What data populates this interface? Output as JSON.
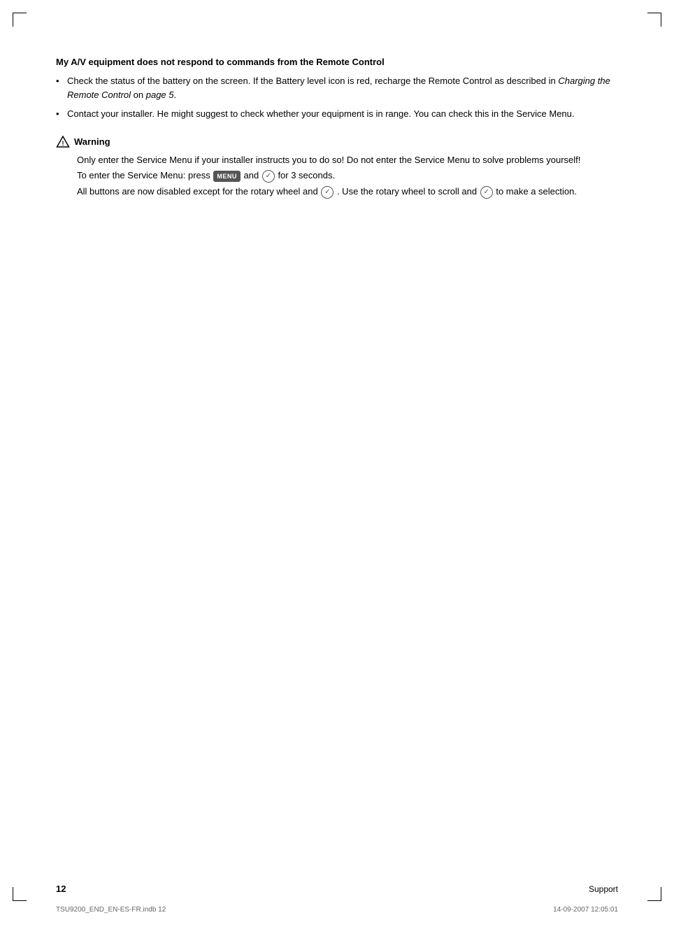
{
  "page": {
    "number": "12",
    "footer_label": "Support",
    "file_info_left": "TSU9200_END_EN-ES-FR.indb   12",
    "file_info_right": "14-09-2007   12:05:01"
  },
  "section": {
    "heading": "My A/V equipment does not respond to commands from the Remote Control",
    "bullets": [
      {
        "text_before": "Check the status of the battery on the screen. If the Battery level icon is red, recharge the Remote Control as described in ",
        "italic_text": "Charging the Remote Control",
        "text_after": " on ",
        "italic_page": "page 5",
        "text_end": "."
      },
      {
        "text": "Contact your installer. He might suggest to check whether your equipment is in range. You can check this in the Service Menu."
      }
    ]
  },
  "warning": {
    "header": "Warning",
    "lines": [
      "Only enter the Service Menu if your installer instructs you to do so! Do not enter the Service Menu to solve problems yourself!",
      "To enter the Service Menu: press",
      "for 3 seconds.",
      "All buttons are now disabled except for the rotary wheel and",
      ". Use the rotary wheel to scroll and",
      "to make a selection."
    ],
    "menu_button_label": "MENU",
    "check_symbol": "✓"
  }
}
